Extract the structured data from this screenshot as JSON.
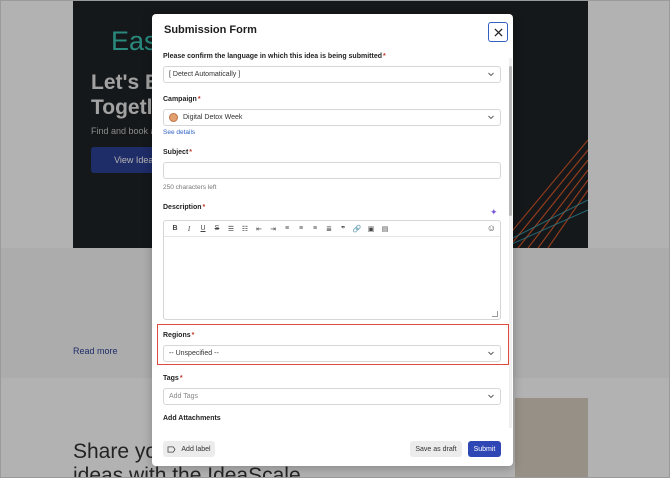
{
  "background": {
    "brand": "Eas",
    "hero_title_line1": "Let's B",
    "hero_title_line2": "Togetl",
    "hero_sub": "Find and book a",
    "hero_button": "View Ideas",
    "read_more": "Read more",
    "share_line1": "Share yo",
    "share_line2": "ideas with the IdeaScale"
  },
  "modal": {
    "title": "Submission Form",
    "language": {
      "label": "Please confirm the language in which this idea is being submitted",
      "required": "*",
      "value": "[ Detect Automatically ]"
    },
    "campaign": {
      "label": "Campaign",
      "required": "*",
      "value": "Digital Detox Week",
      "details_link": "See details"
    },
    "subject": {
      "label": "Subject",
      "required": "*",
      "value": "",
      "hint": "250 characters left"
    },
    "description": {
      "label": "Description",
      "required": "*",
      "toolbar": [
        "bold-icon",
        "italic-icon",
        "underline-icon",
        "strikethrough-icon",
        "bullet-list-icon",
        "numbered-list-icon",
        "outdent-icon",
        "indent-icon",
        "align-left-icon",
        "align-center-icon",
        "align-right-icon",
        "justify-icon",
        "quote-icon",
        "link-icon",
        "video-icon",
        "image-icon",
        "emoji-icon"
      ]
    },
    "regions": {
      "label": "Regions",
      "required": "*",
      "value": "-- Unspecified --"
    },
    "tags": {
      "label": "Tags",
      "required": "*",
      "placeholder": "Add Tags"
    },
    "attachments": {
      "label": "Add Attachments"
    },
    "footer": {
      "add_label": "Add label",
      "save_draft": "Save as draft",
      "submit": "Submit"
    }
  },
  "colors": {
    "accent": "#2f47b4",
    "highlight": "#e04a3f",
    "link": "#2f5fc4"
  }
}
